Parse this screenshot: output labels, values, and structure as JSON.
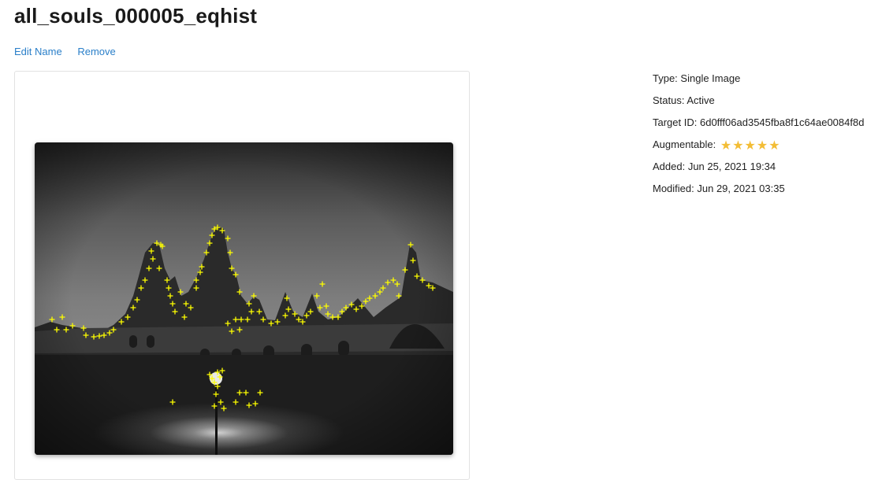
{
  "header": {
    "title": "all_souls_000005_eqhist"
  },
  "actions": {
    "edit_label": "Edit Name",
    "remove_label": "Remove"
  },
  "target_info": {
    "type_label": "Type:",
    "type_value": "Single Image",
    "status_label": "Status:",
    "status_value": "Active",
    "target_id_label": "Target ID:",
    "target_id_value": "6d0fff06ad3545fba8f1c64ae0084f8d",
    "augmentable_label": "Augmentable:",
    "augmentable_rating": 5,
    "augmentable_max": 5,
    "added_label": "Added:",
    "added_value": "Jun 25, 2021 19:34",
    "modified_label": "Modified:",
    "modified_value": "Jun 29, 2021 03:35"
  },
  "colors": {
    "link": "#2a7fc9",
    "star": "#f3bd35",
    "feature_marker": "#ffff00"
  },
  "icons": {
    "star": "star-icon",
    "feature": "plus-marker-icon"
  }
}
